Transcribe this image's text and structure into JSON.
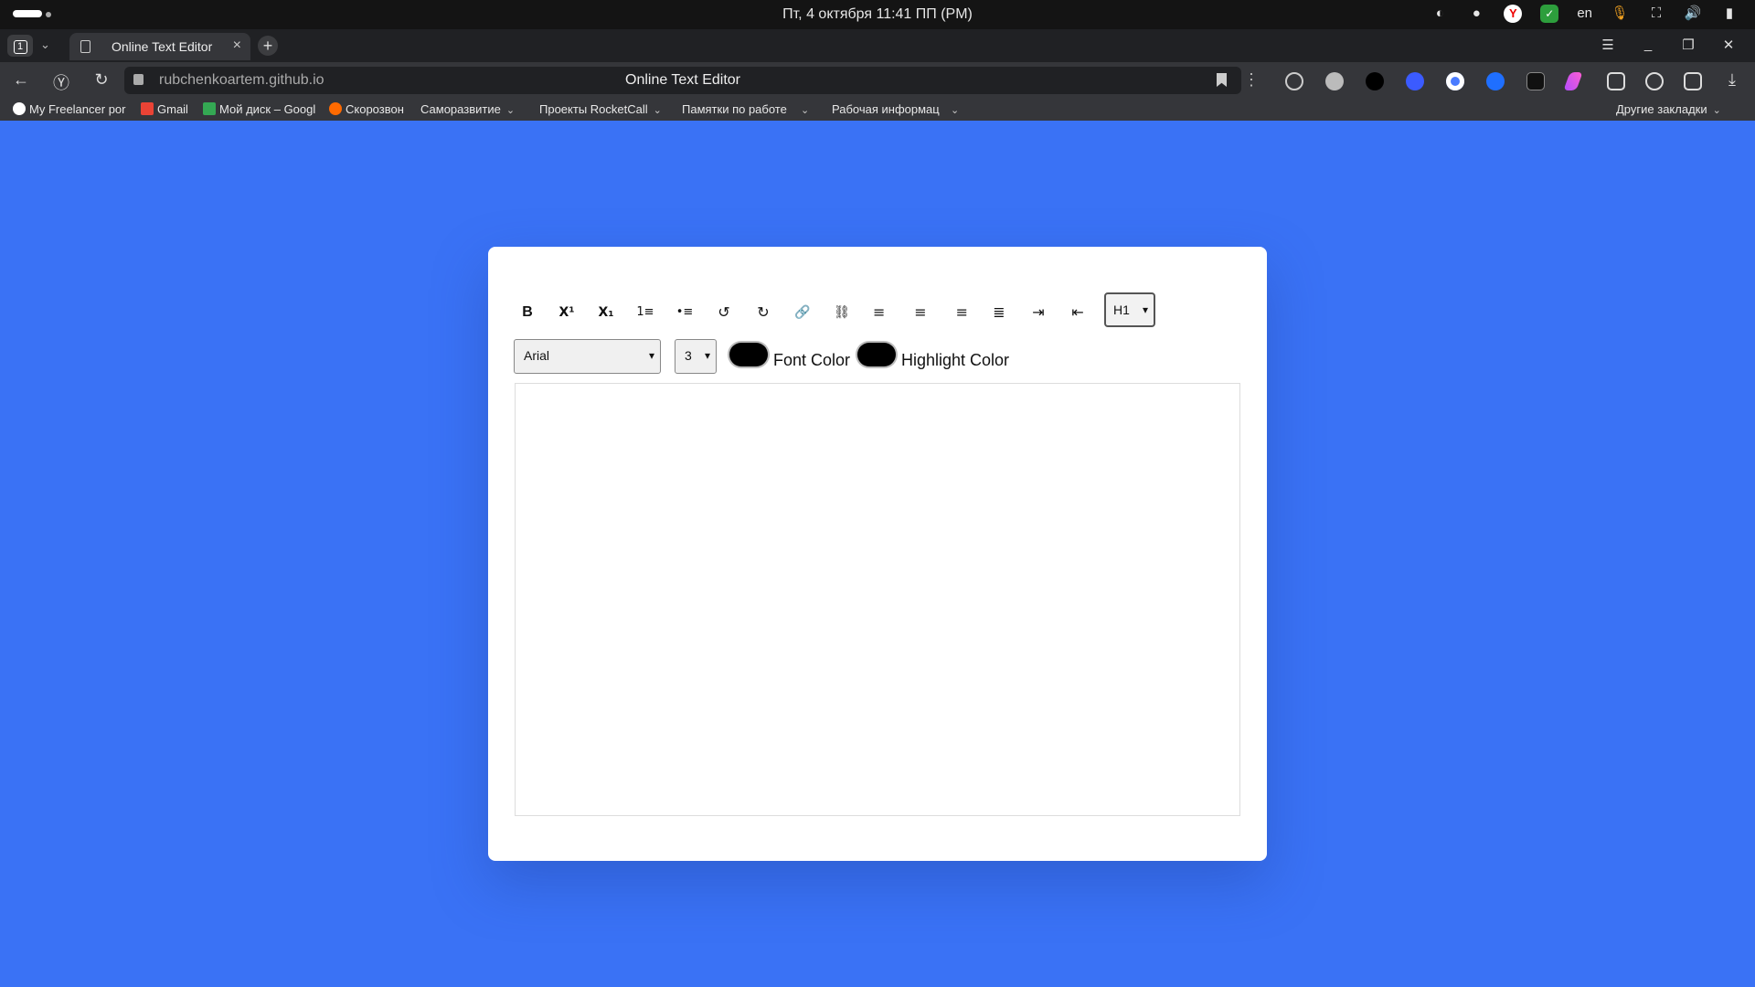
{
  "os": {
    "clock": "Пт, 4 октября  11:41 ПП (PM)",
    "tray": [
      "steam-icon",
      "globe-icon",
      "yandex-icon",
      "check-icon",
      "en",
      "mic-icon",
      "network-icon",
      "volume-icon",
      "battery-icon"
    ],
    "lang": "en"
  },
  "browser": {
    "tab_count": "1",
    "tab_title": "Online Text Editor",
    "url_host": "rubchenkoartem.github.io",
    "page_title": "Online Text Editor",
    "extensions": [
      "bulb-icon",
      "globe-icon",
      "gnome-icon",
      "at-icon",
      "circle-icon",
      "shazam-icon",
      "cat-icon",
      "feather-icon",
      "screenshot-icon",
      "play-icon",
      "puzzle-icon",
      "download-icon"
    ],
    "bookmarks": [
      {
        "label": "My Freelancer por",
        "color": "#ffffff"
      },
      {
        "label": "Gmail",
        "color": "#ea4335"
      },
      {
        "label": "Мой диск – Googl",
        "color": "#34a853"
      },
      {
        "label": "Скорозвон",
        "color": "#ff6a00"
      },
      {
        "label": "Саморазвитие",
        "folder": true
      },
      {
        "label": "Проекты RocketCall",
        "folder": true
      },
      {
        "label": "Памятки по работе",
        "folder": true
      },
      {
        "label": "Рабочая информац",
        "folder": true
      }
    ],
    "other_bookmarks": "Другие закладки"
  },
  "editor": {
    "toolbar": [
      {
        "name": "bold-button",
        "glyph": "B"
      },
      {
        "name": "superscript-button",
        "glyph": "X¹"
      },
      {
        "name": "subscript-button",
        "glyph": "X₁"
      },
      {
        "name": "ordered-list-button",
        "glyph": "1≡"
      },
      {
        "name": "unordered-list-button",
        "glyph": "•≡"
      },
      {
        "name": "undo-button",
        "glyph": "↺"
      },
      {
        "name": "redo-button",
        "glyph": "↻"
      },
      {
        "name": "link-button",
        "glyph": "🔗"
      },
      {
        "name": "unlink-button",
        "glyph": "⛓"
      },
      {
        "name": "align-left-button",
        "glyph": "≡"
      },
      {
        "name": "align-center-button",
        "glyph": "≡"
      },
      {
        "name": "align-right-button",
        "glyph": "≡"
      },
      {
        "name": "justify-button",
        "glyph": "≣"
      },
      {
        "name": "indent-button",
        "glyph": "⇥"
      },
      {
        "name": "outdent-button",
        "glyph": "⇤"
      }
    ],
    "heading_select": "H1",
    "font_select": "Arial",
    "size_select": "3",
    "font_color_label": "Font Color",
    "highlight_color_label": "Highlight Color",
    "font_color": "#000000",
    "highlight_color": "#000000",
    "background": "#3a72f5"
  }
}
